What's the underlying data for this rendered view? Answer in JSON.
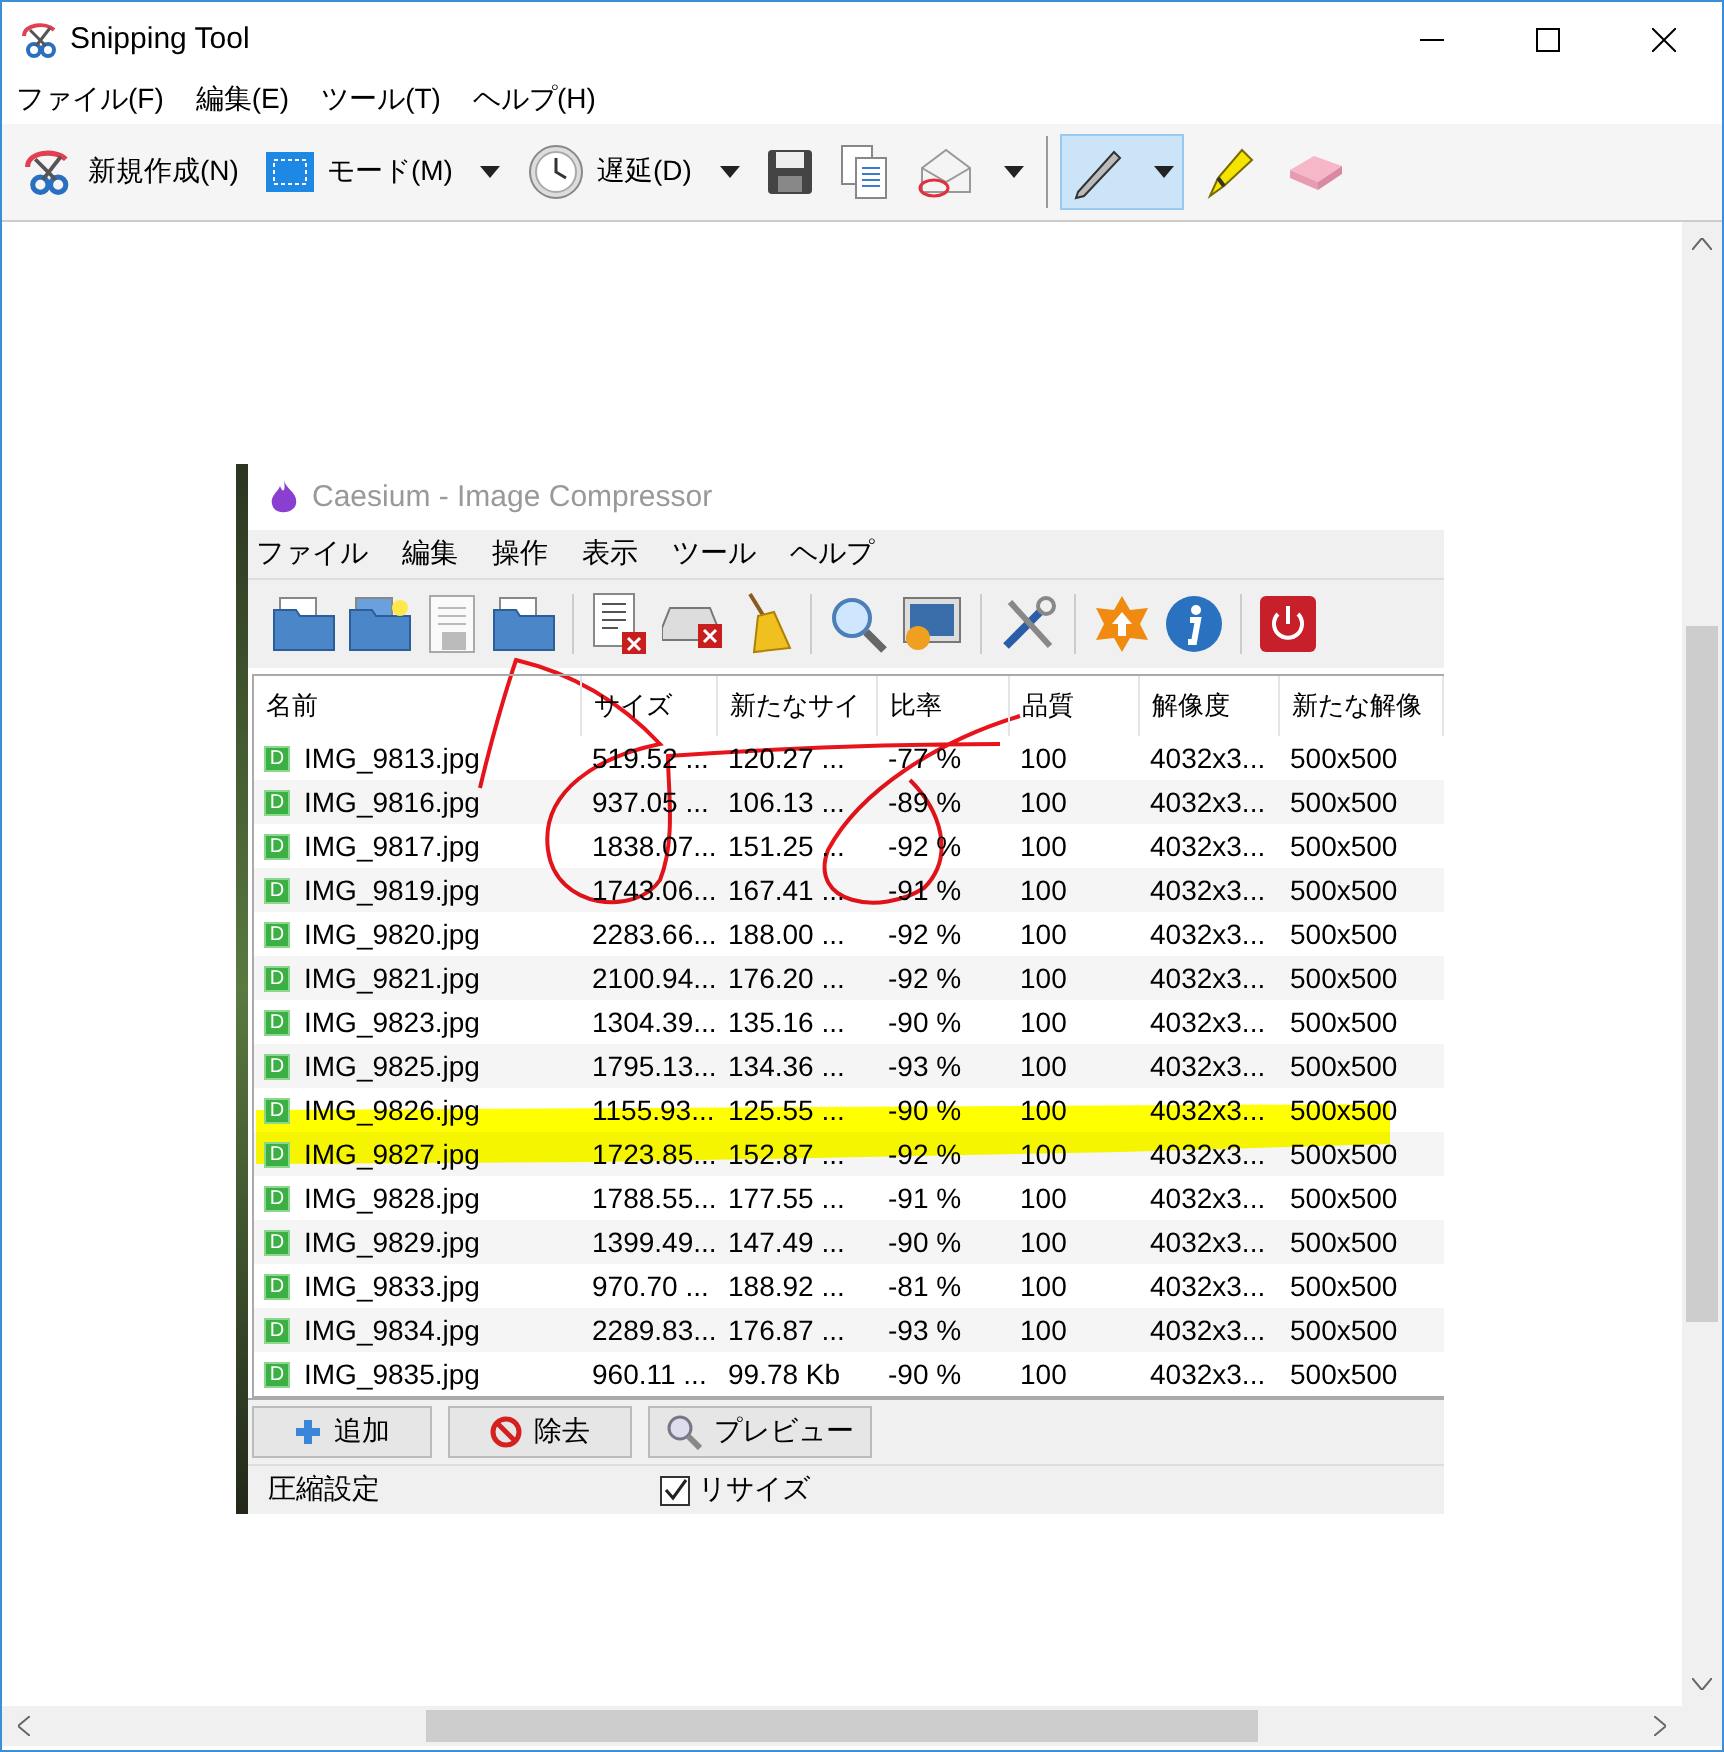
{
  "window": {
    "title": "Snipping Tool"
  },
  "menu": [
    "ファイル(F)",
    "編集(E)",
    "ツール(T)",
    "ヘルプ(H)"
  ],
  "toolbar": [
    {
      "kind": "new",
      "label": "新規作成(N)",
      "dropdown": false,
      "selected": false
    },
    {
      "kind": "mode",
      "label": "モード(M)",
      "dropdown": true,
      "selected": false
    },
    {
      "kind": "delay",
      "label": "遅延(D)",
      "dropdown": true,
      "selected": false
    },
    {
      "kind": "save",
      "dropdown": false,
      "selected": false
    },
    {
      "kind": "copy",
      "dropdown": false,
      "selected": false
    },
    {
      "kind": "send",
      "dropdown": true,
      "selected": false
    },
    {
      "kind": "pen",
      "dropdown": true,
      "selected": true
    },
    {
      "kind": "highlighter",
      "dropdown": false,
      "selected": false
    },
    {
      "kind": "eraser",
      "dropdown": false,
      "selected": false
    }
  ],
  "captured_image": {
    "title": "Caesium - Image Compressor",
    "menu": [
      "ファイル",
      "編集",
      "操作",
      "表示",
      "ツール",
      "ヘルプ"
    ],
    "table": {
      "columns": [
        "名前",
        "サイズ",
        "新たなサイ",
        "比率",
        "品質",
        "解像度",
        "新たな解像"
      ],
      "rows": [
        {
          "icon_letter": "D",
          "cells": [
            "IMG_9813.jpg",
            "519.52 ...",
            "120.27 ...",
            "-77 %",
            "100",
            "4032x3...",
            "500x500"
          ]
        },
        {
          "icon_letter": "D",
          "cells": [
            "IMG_9816.jpg",
            "937.05 ...",
            "106.13 ...",
            "-89 %",
            "100",
            "4032x3...",
            "500x500"
          ]
        },
        {
          "icon_letter": "D",
          "cells": [
            "IMG_9817.jpg",
            "1838.07...",
            "151.25 ...",
            "-92 %",
            "100",
            "4032x3...",
            "500x500"
          ]
        },
        {
          "icon_letter": "D",
          "cells": [
            "IMG_9819.jpg",
            "1743.06...",
            "167.41 ...",
            "-91 %",
            "100",
            "4032x3...",
            "500x500"
          ]
        },
        {
          "icon_letter": "D",
          "cells": [
            "IMG_9820.jpg",
            "2283.66...",
            "188.00 ...",
            "-92 %",
            "100",
            "4032x3...",
            "500x500"
          ]
        },
        {
          "icon_letter": "D",
          "cells": [
            "IMG_9821.jpg",
            "2100.94...",
            "176.20 ...",
            "-92 %",
            "100",
            "4032x3...",
            "500x500"
          ]
        },
        {
          "icon_letter": "D",
          "cells": [
            "IMG_9823.jpg",
            "1304.39...",
            "135.16 ...",
            "-90 %",
            "100",
            "4032x3...",
            "500x500"
          ]
        },
        {
          "icon_letter": "D",
          "cells": [
            "IMG_9825.jpg",
            "1795.13...",
            "134.36 ...",
            "-93 %",
            "100",
            "4032x3...",
            "500x500"
          ]
        },
        {
          "icon_letter": "D",
          "cells": [
            "IMG_9826.jpg",
            "1155.93...",
            "125.55 ...",
            "-90 %",
            "100",
            "4032x3...",
            "500x500"
          ]
        },
        {
          "icon_letter": "D",
          "cells": [
            "IMG_9827.jpg",
            "1723.85...",
            "152.87 ...",
            "-92 %",
            "100",
            "4032x3...",
            "500x500"
          ]
        },
        {
          "icon_letter": "D",
          "cells": [
            "IMG_9828.jpg",
            "1788.55...",
            "177.55 ...",
            "-91 %",
            "100",
            "4032x3...",
            "500x500"
          ]
        },
        {
          "icon_letter": "D",
          "cells": [
            "IMG_9829.jpg",
            "1399.49...",
            "147.49 ...",
            "-90 %",
            "100",
            "4032x3...",
            "500x500"
          ]
        },
        {
          "icon_letter": "D",
          "cells": [
            "IMG_9833.jpg",
            "970.70 ...",
            "188.92 ...",
            "-81 %",
            "100",
            "4032x3...",
            "500x500"
          ]
        },
        {
          "icon_letter": "D",
          "cells": [
            "IMG_9834.jpg",
            "2289.83...",
            "176.87 ...",
            "-93 %",
            "100",
            "4032x3...",
            "500x500"
          ]
        },
        {
          "icon_letter": "D",
          "cells": [
            "IMG_9835.jpg",
            "960.11 ...",
            "99.78 Kb",
            "-90 %",
            "100",
            "4032x3...",
            "500x500"
          ]
        }
      ]
    },
    "buttons": [
      {
        "kind": "add",
        "label": "追加"
      },
      {
        "kind": "remove",
        "label": "除去"
      },
      {
        "kind": "preview",
        "label": "プレビュー"
      }
    ],
    "settings": {
      "group_label": "圧縮設定",
      "resize": {
        "label": "リサイズ",
        "checked": true
      }
    }
  }
}
